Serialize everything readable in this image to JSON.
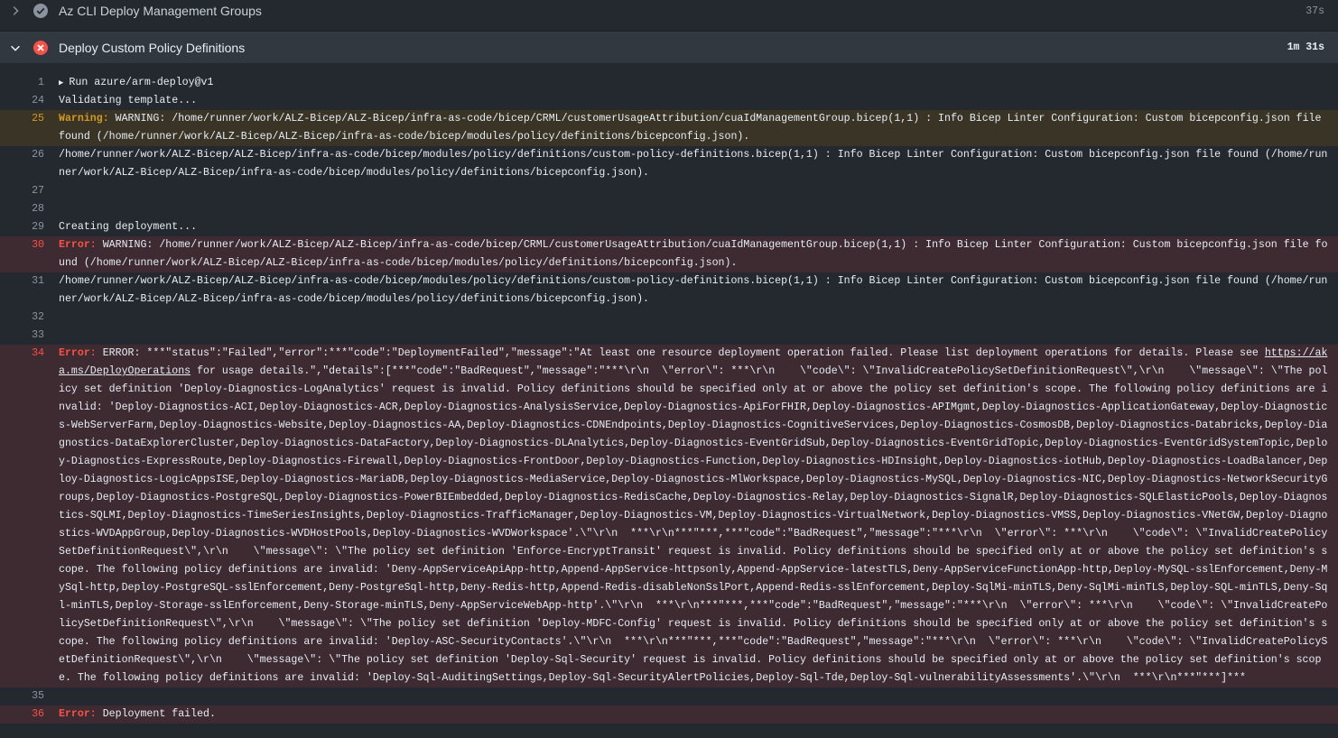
{
  "steps": [
    {
      "title": "Az CLI Deploy Management Groups",
      "duration": "37s"
    },
    {
      "title": "Deploy Custom Policy Definitions",
      "duration": "1m 31s"
    }
  ],
  "log": {
    "run": {
      "num": "1",
      "text": "Run azure/arm-deploy@v1"
    },
    "l24": {
      "num": "24",
      "text": "Validating template..."
    },
    "l25": {
      "num": "25",
      "label": "Warning:",
      "text": " WARNING: /home/runner/work/ALZ-Bicep/ALZ-Bicep/infra-as-code/bicep/CRML/customerUsageAttribution/cuaIdManagementGroup.bicep(1,1) : Info Bicep Linter Configuration: Custom bicepconfig.json file found (/home/runner/work/ALZ-Bicep/ALZ-Bicep/infra-as-code/bicep/modules/policy/definitions/bicepconfig.json)."
    },
    "l26": {
      "num": "26",
      "text": "/home/runner/work/ALZ-Bicep/ALZ-Bicep/infra-as-code/bicep/modules/policy/definitions/custom-policy-definitions.bicep(1,1) : Info Bicep Linter Configuration: Custom bicepconfig.json file found (/home/runner/work/ALZ-Bicep/ALZ-Bicep/infra-as-code/bicep/modules/policy/definitions/bicepconfig.json)."
    },
    "l27": {
      "num": "27",
      "text": ""
    },
    "l28": {
      "num": "28",
      "text": ""
    },
    "l29": {
      "num": "29",
      "text": "Creating deployment..."
    },
    "l30": {
      "num": "30",
      "label": "Error:",
      "text": " WARNING: /home/runner/work/ALZ-Bicep/ALZ-Bicep/infra-as-code/bicep/CRML/customerUsageAttribution/cuaIdManagementGroup.bicep(1,1) : Info Bicep Linter Configuration: Custom bicepconfig.json file found (/home/runner/work/ALZ-Bicep/ALZ-Bicep/infra-as-code/bicep/modules/policy/definitions/bicepconfig.json)."
    },
    "l31": {
      "num": "31",
      "text": "/home/runner/work/ALZ-Bicep/ALZ-Bicep/infra-as-code/bicep/modules/policy/definitions/custom-policy-definitions.bicep(1,1) : Info Bicep Linter Configuration: Custom bicepconfig.json file found (/home/runner/work/ALZ-Bicep/ALZ-Bicep/infra-as-code/bicep/modules/policy/definitions/bicepconfig.json)."
    },
    "l32": {
      "num": "32",
      "text": ""
    },
    "l33": {
      "num": "33",
      "text": ""
    },
    "l34": {
      "num": "34",
      "label": "Error:",
      "pre": " ERROR: ***\"status\":\"Failed\",\"error\":***\"code\":\"DeploymentFailed\",\"message\":\"At least one resource deployment operation failed. Please list deployment operations for details. Please see ",
      "link": "https://aka.ms/DeployOperations",
      "post": " for usage details.\",\"details\":[***\"code\":\"BadRequest\",\"message\":\"***\\r\\n  \\\"error\\\": ***\\r\\n    \\\"code\\\": \\\"InvalidCreatePolicySetDefinitionRequest\\\",\\r\\n    \\\"message\\\": \\\"The policy set definition 'Deploy-Diagnostics-LogAnalytics' request is invalid. Policy definitions should be specified only at or above the policy set definition's scope. The following policy definitions are invalid: 'Deploy-Diagnostics-ACI,Deploy-Diagnostics-ACR,Deploy-Diagnostics-AnalysisService,Deploy-Diagnostics-ApiForFHIR,Deploy-Diagnostics-APIMgmt,Deploy-Diagnostics-ApplicationGateway,Deploy-Diagnostics-WebServerFarm,Deploy-Diagnostics-Website,Deploy-Diagnostics-AA,Deploy-Diagnostics-CDNEndpoints,Deploy-Diagnostics-CognitiveServices,Deploy-Diagnostics-CosmosDB,Deploy-Diagnostics-Databricks,Deploy-Diagnostics-DataExplorerCluster,Deploy-Diagnostics-DataFactory,Deploy-Diagnostics-DLAnalytics,Deploy-Diagnostics-EventGridSub,Deploy-Diagnostics-EventGridTopic,Deploy-Diagnostics-EventGridSystemTopic,Deploy-Diagnostics-ExpressRoute,Deploy-Diagnostics-Firewall,Deploy-Diagnostics-FrontDoor,Deploy-Diagnostics-Function,Deploy-Diagnostics-HDInsight,Deploy-Diagnostics-iotHub,Deploy-Diagnostics-LoadBalancer,Deploy-Diagnostics-LogicAppsISE,Deploy-Diagnostics-MariaDB,Deploy-Diagnostics-MediaService,Deploy-Diagnostics-MlWorkspace,Deploy-Diagnostics-MySQL,Deploy-Diagnostics-NIC,Deploy-Diagnostics-NetworkSecurityGroups,Deploy-Diagnostics-PostgreSQL,Deploy-Diagnostics-PowerBIEmbedded,Deploy-Diagnostics-RedisCache,Deploy-Diagnostics-Relay,Deploy-Diagnostics-SignalR,Deploy-Diagnostics-SQLElasticPools,Deploy-Diagnostics-SQLMI,Deploy-Diagnostics-TimeSeriesInsights,Deploy-Diagnostics-TrafficManager,Deploy-Diagnostics-VM,Deploy-Diagnostics-VirtualNetwork,Deploy-Diagnostics-VMSS,Deploy-Diagnostics-VNetGW,Deploy-Diagnostics-WVDAppGroup,Deploy-Diagnostics-WVDHostPools,Deploy-Diagnostics-WVDWorkspace'.\\\"\\r\\n  ***\\r\\n***\"***,***\"code\":\"BadRequest\",\"message\":\"***\\r\\n  \\\"error\\\": ***\\r\\n    \\\"code\\\": \\\"InvalidCreatePolicySetDefinitionRequest\\\",\\r\\n    \\\"message\\\": \\\"The policy set definition 'Enforce-EncryptTransit' request is invalid. Policy definitions should be specified only at or above the policy set definition's scope. The following policy definitions are invalid: 'Deny-AppServiceApiApp-http,Append-AppService-httpsonly,Append-AppService-latestTLS,Deny-AppServiceFunctionApp-http,Deploy-MySQL-sslEnforcement,Deny-MySql-http,Deploy-PostgreSQL-sslEnforcement,Deny-PostgreSql-http,Deny-Redis-http,Append-Redis-disableNonSslPort,Append-Redis-sslEnforcement,Deploy-SqlMi-minTLS,Deny-SqlMi-minTLS,Deploy-SQL-minTLS,Deny-Sql-minTLS,Deploy-Storage-sslEnforcement,Deny-Storage-minTLS,Deny-AppServiceWebApp-http'.\\\"\\r\\n  ***\\r\\n***\"***,***\"code\":\"BadRequest\",\"message\":\"***\\r\\n  \\\"error\\\": ***\\r\\n    \\\"code\\\": \\\"InvalidCreatePolicySetDefinitionRequest\\\",\\r\\n    \\\"message\\\": \\\"The policy set definition 'Deploy-MDFC-Config' request is invalid. Policy definitions should be specified only at or above the policy set definition's scope. The following policy definitions are invalid: 'Deploy-ASC-SecurityContacts'.\\\"\\r\\n  ***\\r\\n***\"***,***\"code\":\"BadRequest\",\"message\":\"***\\r\\n  \\\"error\\\": ***\\r\\n    \\\"code\\\": \\\"InvalidCreatePolicySetDefinitionRequest\\\",\\r\\n    \\\"message\\\": \\\"The policy set definition 'Deploy-Sql-Security' request is invalid. Policy definitions should be specified only at or above the policy set definition's scope. The following policy definitions are invalid: 'Deploy-Sql-AuditingSettings,Deploy-Sql-SecurityAlertPolicies,Deploy-Sql-Tde,Deploy-Sql-vulnerabilityAssessments'.\\\"\\r\\n  ***\\r\\n***\"***]***"
    },
    "l35": {
      "num": "35",
      "text": ""
    },
    "l36": {
      "num": "36",
      "label": "Error:",
      "text": " Deployment failed."
    }
  }
}
